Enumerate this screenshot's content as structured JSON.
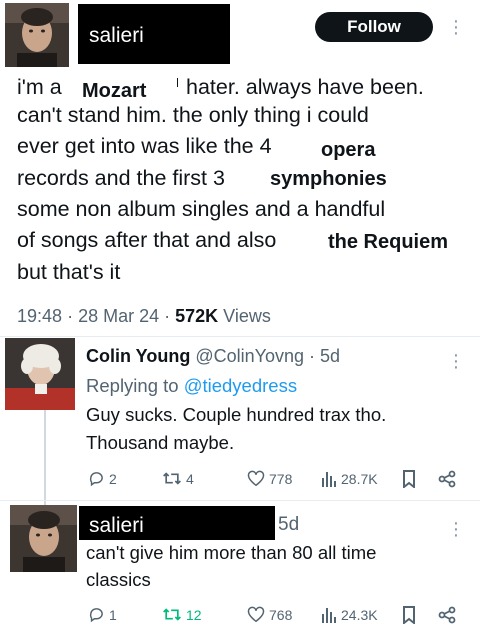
{
  "main_tweet": {
    "username": "salieri",
    "follow_label": "Follow",
    "lines": [
      "i'm a",
      "hater. always have been.",
      "can't stand him. the only thing i could",
      "ever get into was like the 4",
      "records and the first 3",
      "some non album singles and a handful",
      "of songs after that and also",
      "but that's it"
    ],
    "overlays": {
      "mozart": "Mozart",
      "opera": "opera",
      "symphonies": "symphonies",
      "requiem": "the Requiem"
    },
    "time": "19:48",
    "date": "28 Mar 24",
    "views_count": "572K",
    "views_label": "Views"
  },
  "reply1": {
    "name": "Colin Young",
    "handle": "@ColinYovng",
    "age": "· 5d",
    "replying_prefix": "Replying to",
    "replying_handle": "@tiedyedress",
    "lines": [
      "Guy sucks. Couple hundred trax tho.",
      "Thousand maybe."
    ],
    "replies": "2",
    "retweets": "4",
    "likes": "778",
    "views": "28.7K"
  },
  "reply2": {
    "username": "salieri",
    "age": "5d",
    "lines": [
      "can't give him more than 80 all time",
      "classics"
    ],
    "replies": "1",
    "retweets": "12",
    "likes": "768",
    "views": "24.3K",
    "retweet_color": "#00ba7c"
  },
  "colors": {
    "text": "#0f1419",
    "secondary": "#536471",
    "link": "#1d9bf0"
  }
}
